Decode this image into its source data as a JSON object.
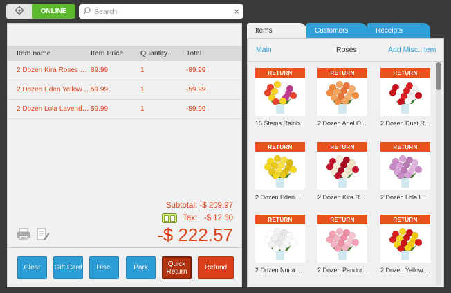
{
  "topbar": {
    "status": "ONLINE",
    "search_placeholder": "Search",
    "clear_icon": "×"
  },
  "cart": {
    "columns": [
      "Item name",
      "Item Price",
      "Quantity",
      "Total"
    ],
    "rows": [
      {
        "name": "2 Dozen Kira Roses Pu...",
        "price": "89.99",
        "qty": "1",
        "total": "-89.99"
      },
      {
        "name": "2 Dozen Eden Yellow R...",
        "price": "59.99",
        "qty": "1",
        "total": "-59.99"
      },
      {
        "name": "2 Dozen Lola Lavender...",
        "price": "59.99",
        "qty": "1",
        "total": "-59.99"
      }
    ],
    "subtotal": "Subtotal:  -$ 209.97",
    "tax": "Tax:   -$ 12.60",
    "grand_total": "-$ 222.57"
  },
  "actions": {
    "clear": "Clear",
    "gift_card": "Gift Card",
    "disc": "Disc.",
    "park": "Park",
    "quick_return": "Quick Return",
    "refund": "Refund"
  },
  "tabs": {
    "items": "Items",
    "customers": "Customers",
    "receipts": "Receipts"
  },
  "catalog_nav": {
    "main": "Main",
    "category": "Roses",
    "add_misc": "Add Misc. Item"
  },
  "products": [
    {
      "badge": "RETURN",
      "name": "15 Stems Rainb...",
      "colors": [
        "#e8432c",
        "#f7d21e",
        "#ffffff",
        "#c03a8f"
      ]
    },
    {
      "badge": "RETURN",
      "name": "2 Dozen Ariel O...",
      "colors": [
        "#f08a3c",
        "#f4a45c",
        "#e8763a",
        "#f6b070"
      ]
    },
    {
      "badge": "RETURN",
      "name": "2 Dozen Duet R...",
      "colors": [
        "#c8101c",
        "#ffffff",
        "#d91e24",
        "#f2f2f2"
      ]
    },
    {
      "badge": "RETURN",
      "name": "2 Dozen Eden ...",
      "colors": [
        "#f4d81c",
        "#e9c71a",
        "#f8e04a",
        "#dcbc10"
      ]
    },
    {
      "badge": "RETURN",
      "name": "2 Dozen Kira R...",
      "colors": [
        "#c0122a",
        "#f5ecd8",
        "#a80f22",
        "#efe2c6"
      ]
    },
    {
      "badge": "RETURN",
      "name": "2 Dozen Lola L...",
      "colors": [
        "#c98ac6",
        "#d7a0d4",
        "#b97ab5",
        "#e3b6e0"
      ]
    },
    {
      "badge": "RETURN",
      "name": "2 Dozen Nuria ...",
      "colors": [
        "#ffffff",
        "#f2f2f2",
        "#e8e8e8",
        "#fafafa"
      ]
    },
    {
      "badge": "RETURN",
      "name": "2 Dozen Pandor...",
      "colors": [
        "#f5a3b4",
        "#f2b4c2",
        "#ee8ea2",
        "#f8c6d0"
      ]
    },
    {
      "badge": "RETURN",
      "name": "2 Dozen Yellow ...",
      "colors": [
        "#d41e1e",
        "#f4d41c",
        "#c81414",
        "#f0c814"
      ]
    }
  ]
}
